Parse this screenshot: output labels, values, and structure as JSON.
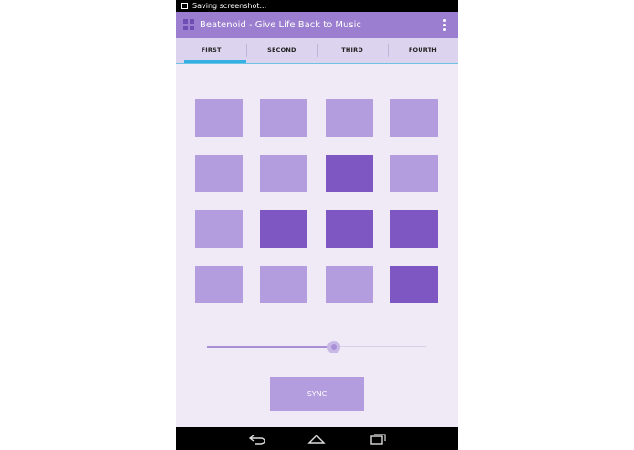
{
  "status_bar": {
    "notification_text": "Saving screenshot...",
    "icon": "image-icon"
  },
  "app_bar": {
    "icon": "grid-icon",
    "title": "Beatenoid - Give Life Back to Music",
    "overflow_icon": "overflow-menu-icon"
  },
  "tabs": [
    {
      "label": "FIRST",
      "active": true
    },
    {
      "label": "SECOND",
      "active": false
    },
    {
      "label": "THIRD",
      "active": false
    },
    {
      "label": "FOURTH",
      "active": false
    }
  ],
  "pad_grid": {
    "rows": 4,
    "columns": 4,
    "states": [
      [
        false,
        false,
        false,
        false
      ],
      [
        false,
        false,
        true,
        false
      ],
      [
        false,
        true,
        true,
        true
      ],
      [
        false,
        false,
        false,
        true
      ]
    ]
  },
  "slider": {
    "value_fraction": 0.58
  },
  "sync_button": {
    "label": "SYNC"
  },
  "nav_bar": {
    "icons": [
      "back-icon",
      "home-icon",
      "recents-icon"
    ]
  },
  "colors": {
    "app_bar": "#9b7ecf",
    "tab_bar": "#dcd3ee",
    "tab_indicator": "#35b0e2",
    "background": "#efeaf6",
    "pad_off": "#b39ddf",
    "pad_on": "#7e57c2"
  }
}
